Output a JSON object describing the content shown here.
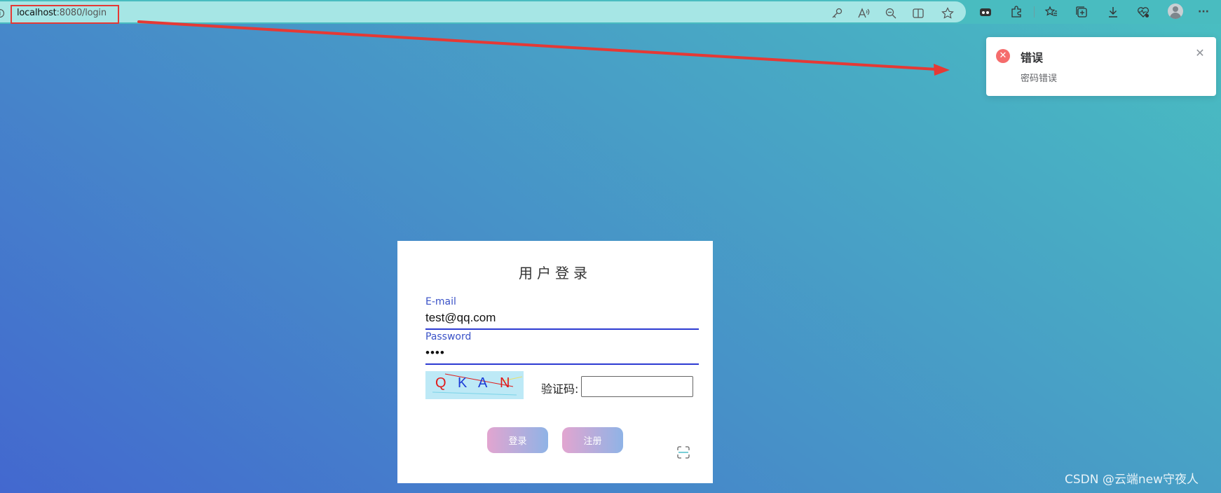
{
  "browser": {
    "url_host": "localhost",
    "url_rest": ":8080/login",
    "info_glyph": "i",
    "toolbar_icons": [
      "key-icon",
      "read-aloud-icon",
      "zoom-icon",
      "split-screen-icon",
      "favorite-icon",
      "game-icon",
      "extensions-icon",
      "favorites-list-icon",
      "collections-icon",
      "download-icon",
      "health-icon",
      "profile-icon",
      "more-icon"
    ],
    "more_glyph": "···"
  },
  "notification": {
    "title": "错误",
    "message": "密码错误",
    "icon_glyph": "✕",
    "close_glyph": "✕",
    "color": "#f56c6c"
  },
  "login": {
    "title": "用户登录",
    "email": {
      "label": "E-mail",
      "value": "test@qq.com"
    },
    "password": {
      "label": "Password",
      "value": "••••"
    },
    "captcha": {
      "chars": [
        {
          "ch": "Q",
          "color": "#e01b1b"
        },
        {
          "ch": "K",
          "color": "#1c3cd6"
        },
        {
          "ch": "A",
          "color": "#1c3cd6"
        },
        {
          "ch": "N",
          "color": "#e01b1b"
        }
      ],
      "label": "验证码:",
      "input_value": ""
    },
    "buttons": {
      "login": "登录",
      "register": "注册"
    }
  },
  "watermark": "CSDN @云端new守夜人",
  "colors": {
    "accent_blue": "#2d3bd2",
    "label_blue": "#3a52c7",
    "annotation_red": "#e53935"
  }
}
